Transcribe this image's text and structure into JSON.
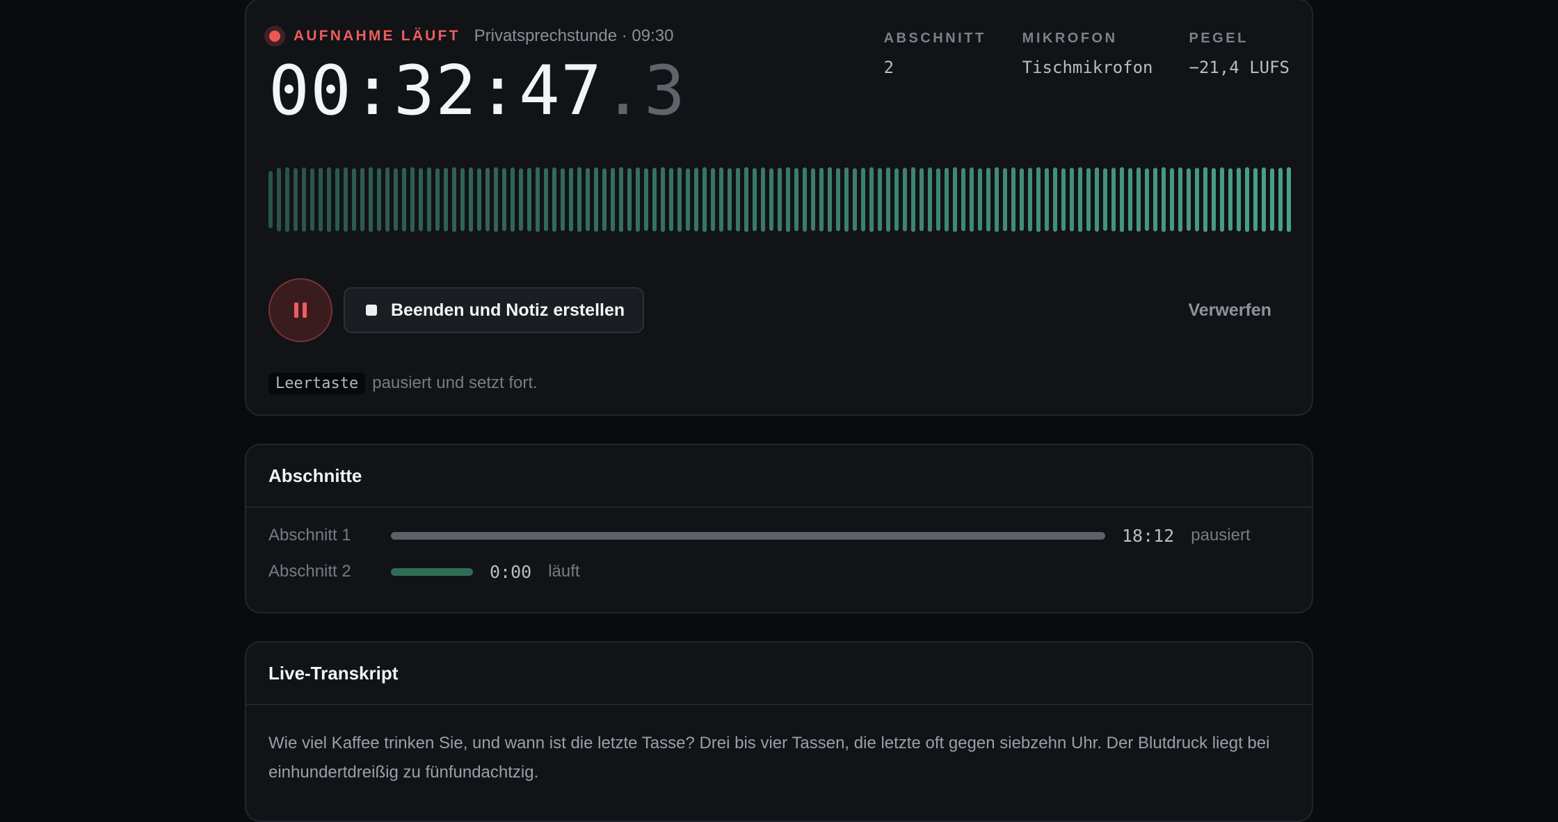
{
  "recorder": {
    "status_label": "AUFNAHME LÄUFT",
    "session_label": "Privatsprechstunde · 09:30",
    "timer_main": "00:32:47",
    "timer_fraction": ".3",
    "meta": [
      {
        "key": "ABSCHNITT",
        "value": "2"
      },
      {
        "key": "MIKROFON",
        "value": "Tischmikrofon"
      },
      {
        "key": "PEGEL",
        "value": "−21,4 LUFS"
      }
    ],
    "finish_label": "Beenden und Notiz erstellen",
    "discard_label": "Verwerfen",
    "hint_key": "Leertaste",
    "hint_text": "pausiert und setzt fort.",
    "colors": {
      "recording": "#eb5757",
      "wave": "#4fae90"
    },
    "icons": {
      "pause": "pause-icon",
      "stop": "stop-icon",
      "record": "record-dot-icon"
    }
  },
  "sections": {
    "title": "Abschnitte",
    "items": [
      {
        "name": "Abschnitt 1",
        "time": "18:12",
        "state": "pausiert",
        "bar_fraction": 0.68,
        "bar_color": "#5d6269"
      },
      {
        "name": "Abschnitt 2",
        "time": "0:00",
        "state": "läuft",
        "bar_fraction": 0.078,
        "bar_color": "#2f6d57"
      }
    ]
  },
  "transcript": {
    "title": "Live-Transkript",
    "text": "Wie viel Kaffee trinken Sie, und wann ist die letzte Tasse? Drei bis vier Tassen, die letzte oft gegen siebzehn Uhr. Der Blutdruck liegt bei einhundertdreißig zu fünfundachtzig."
  }
}
